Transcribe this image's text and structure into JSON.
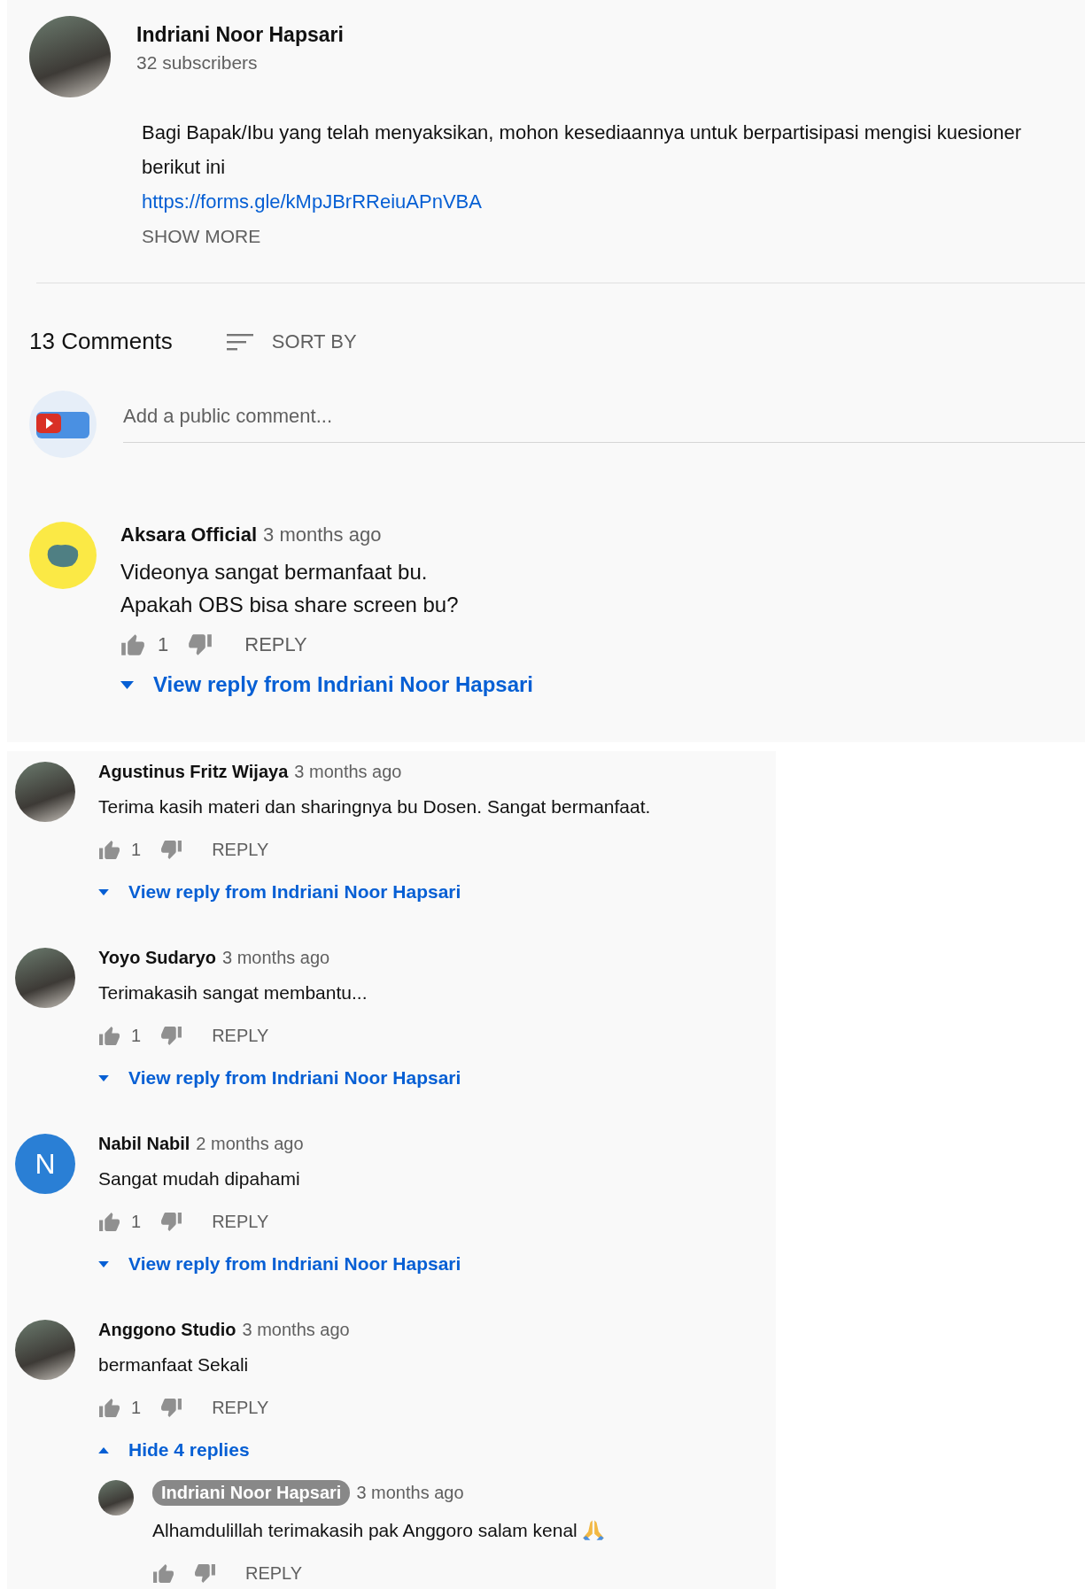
{
  "channel_panel": {
    "channel": {
      "avatar": {
        "kind": "photo"
      },
      "name": "Indriani Noor Hapsari",
      "subscribers": "32 subscribers",
      "description": "Bagi Bapak/Ibu yang telah menyaksikan, mohon kesediaannya untuk berpartisipasi mengisi kuesioner berikut ini",
      "link": "https://forms.gle/kMpJBrRReiuAPnVBA",
      "show_more": "SHOW MORE"
    },
    "comments_header": {
      "count": "13 Comments",
      "sort": "SORT BY"
    },
    "add_comment": {
      "avatar": {
        "kind": "logo"
      },
      "placeholder": "Add a public comment..."
    },
    "comments": [
      {
        "avatar": {
          "kind": "logo"
        },
        "author": "Aksara Official",
        "owner": false,
        "time": "3 months ago",
        "text": "Videonya sangat bermanfaat bu.\nApakah OBS bisa share screen bu?",
        "likes": "1",
        "reply": "REPLY",
        "replies_toggle": {
          "label": "View reply from Indriani Noor Hapsari",
          "expanded": false
        }
      }
    ]
  },
  "more_comments": [
    {
      "avatar": {
        "kind": "photo"
      },
      "author": "Agustinus Fritz Wijaya",
      "owner": false,
      "time": "3 months ago",
      "text": "Terima kasih materi dan sharingnya bu Dosen. Sangat bermanfaat.",
      "likes": "1",
      "reply": "REPLY",
      "replies_toggle": {
        "label": "View reply from Indriani Noor Hapsari",
        "expanded": false
      }
    },
    {
      "avatar": {
        "kind": "photo"
      },
      "author": "Yoyo Sudaryo",
      "owner": false,
      "time": "3 months ago",
      "text": "Terimakasih sangat membantu...",
      "likes": "1",
      "reply": "REPLY",
      "replies_toggle": {
        "label": "View reply from Indriani Noor Hapsari",
        "expanded": false
      }
    },
    {
      "avatar": {
        "kind": "letter",
        "letter": "N"
      },
      "author": "Nabil Nabil",
      "owner": false,
      "time": "2 months ago",
      "text": "Sangat mudah dipahami",
      "likes": "1",
      "reply": "REPLY",
      "replies_toggle": {
        "label": "View reply from Indriani Noor Hapsari",
        "expanded": false
      }
    },
    {
      "avatar": {
        "kind": "photo"
      },
      "author": "Anggono Studio",
      "owner": false,
      "time": "3 months ago",
      "text": "bermanfaat Sekali",
      "likes": "1",
      "reply": "REPLY",
      "replies_toggle": {
        "label": "Hide 4 replies",
        "expanded": true
      },
      "replies": [
        {
          "avatar": {
            "kind": "photo"
          },
          "author": "Indriani Noor Hapsari",
          "owner": true,
          "time": "3 months ago",
          "text": "Alhamdulillah terimakasih pak Anggoro salam kenal",
          "reply": "REPLY"
        }
      ]
    }
  ]
}
